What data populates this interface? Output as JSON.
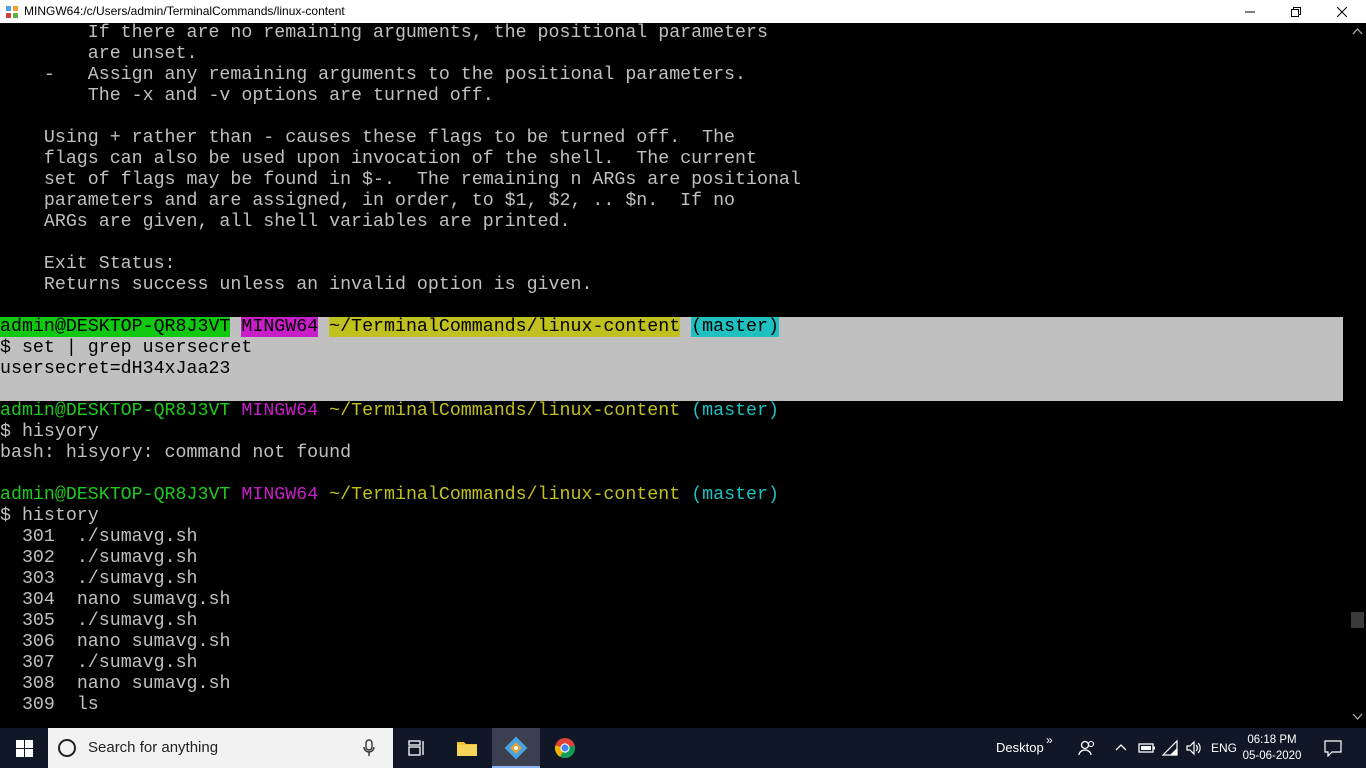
{
  "window": {
    "title": "MINGW64:/c/Users/admin/TerminalCommands/linux-content"
  },
  "terminal": {
    "help_lines": [
      "        If there are no remaining arguments, the positional parameters",
      "        are unset.",
      "    -   Assign any remaining arguments to the positional parameters.",
      "        The -x and -v options are turned off.",
      "",
      "    Using + rather than - causes these flags to be turned off.  The",
      "    flags can also be used upon invocation of the shell.  The current",
      "    set of flags may be found in $-.  The remaining n ARGs are positional",
      "    parameters and are assigned, in order, to $1, $2, .. $n.  If no",
      "    ARGs are given, all shell variables are printed.",
      "",
      "    Exit Status:",
      "    Returns success unless an invalid option is given."
    ],
    "prompt": {
      "user_host": "admin@DESKTOP-QR8J3VT",
      "system": "MINGW64",
      "path": "~/TerminalCommands/linux-content",
      "branch": "(master)"
    },
    "blocks": [
      {
        "command": "$ set | grep usersecret",
        "output": [
          "usersecret=dH34xJaa23"
        ]
      },
      {
        "command": "$ hisyory",
        "output": [
          "bash: hisyory: command not found"
        ]
      },
      {
        "command": "$ history",
        "output": []
      }
    ],
    "history": [
      {
        "num": "301",
        "cmd": "./sumavg.sh"
      },
      {
        "num": "302",
        "cmd": "./sumavg.sh"
      },
      {
        "num": "303",
        "cmd": "./sumavg.sh"
      },
      {
        "num": "304",
        "cmd": "nano sumavg.sh"
      },
      {
        "num": "305",
        "cmd": "./sumavg.sh"
      },
      {
        "num": "306",
        "cmd": "nano sumavg.sh"
      },
      {
        "num": "307",
        "cmd": "./sumavg.sh"
      },
      {
        "num": "308",
        "cmd": "nano sumavg.sh"
      },
      {
        "num": "309",
        "cmd": "ls"
      }
    ]
  },
  "taskbar": {
    "search_placeholder": "Search for anything",
    "desktop_label": "Desktop",
    "chevron": "»",
    "language": "ENG",
    "time": "06:18 PM",
    "date": "05-06-2020"
  },
  "colors": {
    "prompt_user": "#1ec91e",
    "prompt_system": "#c81ec8",
    "prompt_path": "#c0c01e",
    "prompt_branch": "#1ec0c0",
    "selection": "#c0c0c0",
    "taskbar": "#101828"
  }
}
